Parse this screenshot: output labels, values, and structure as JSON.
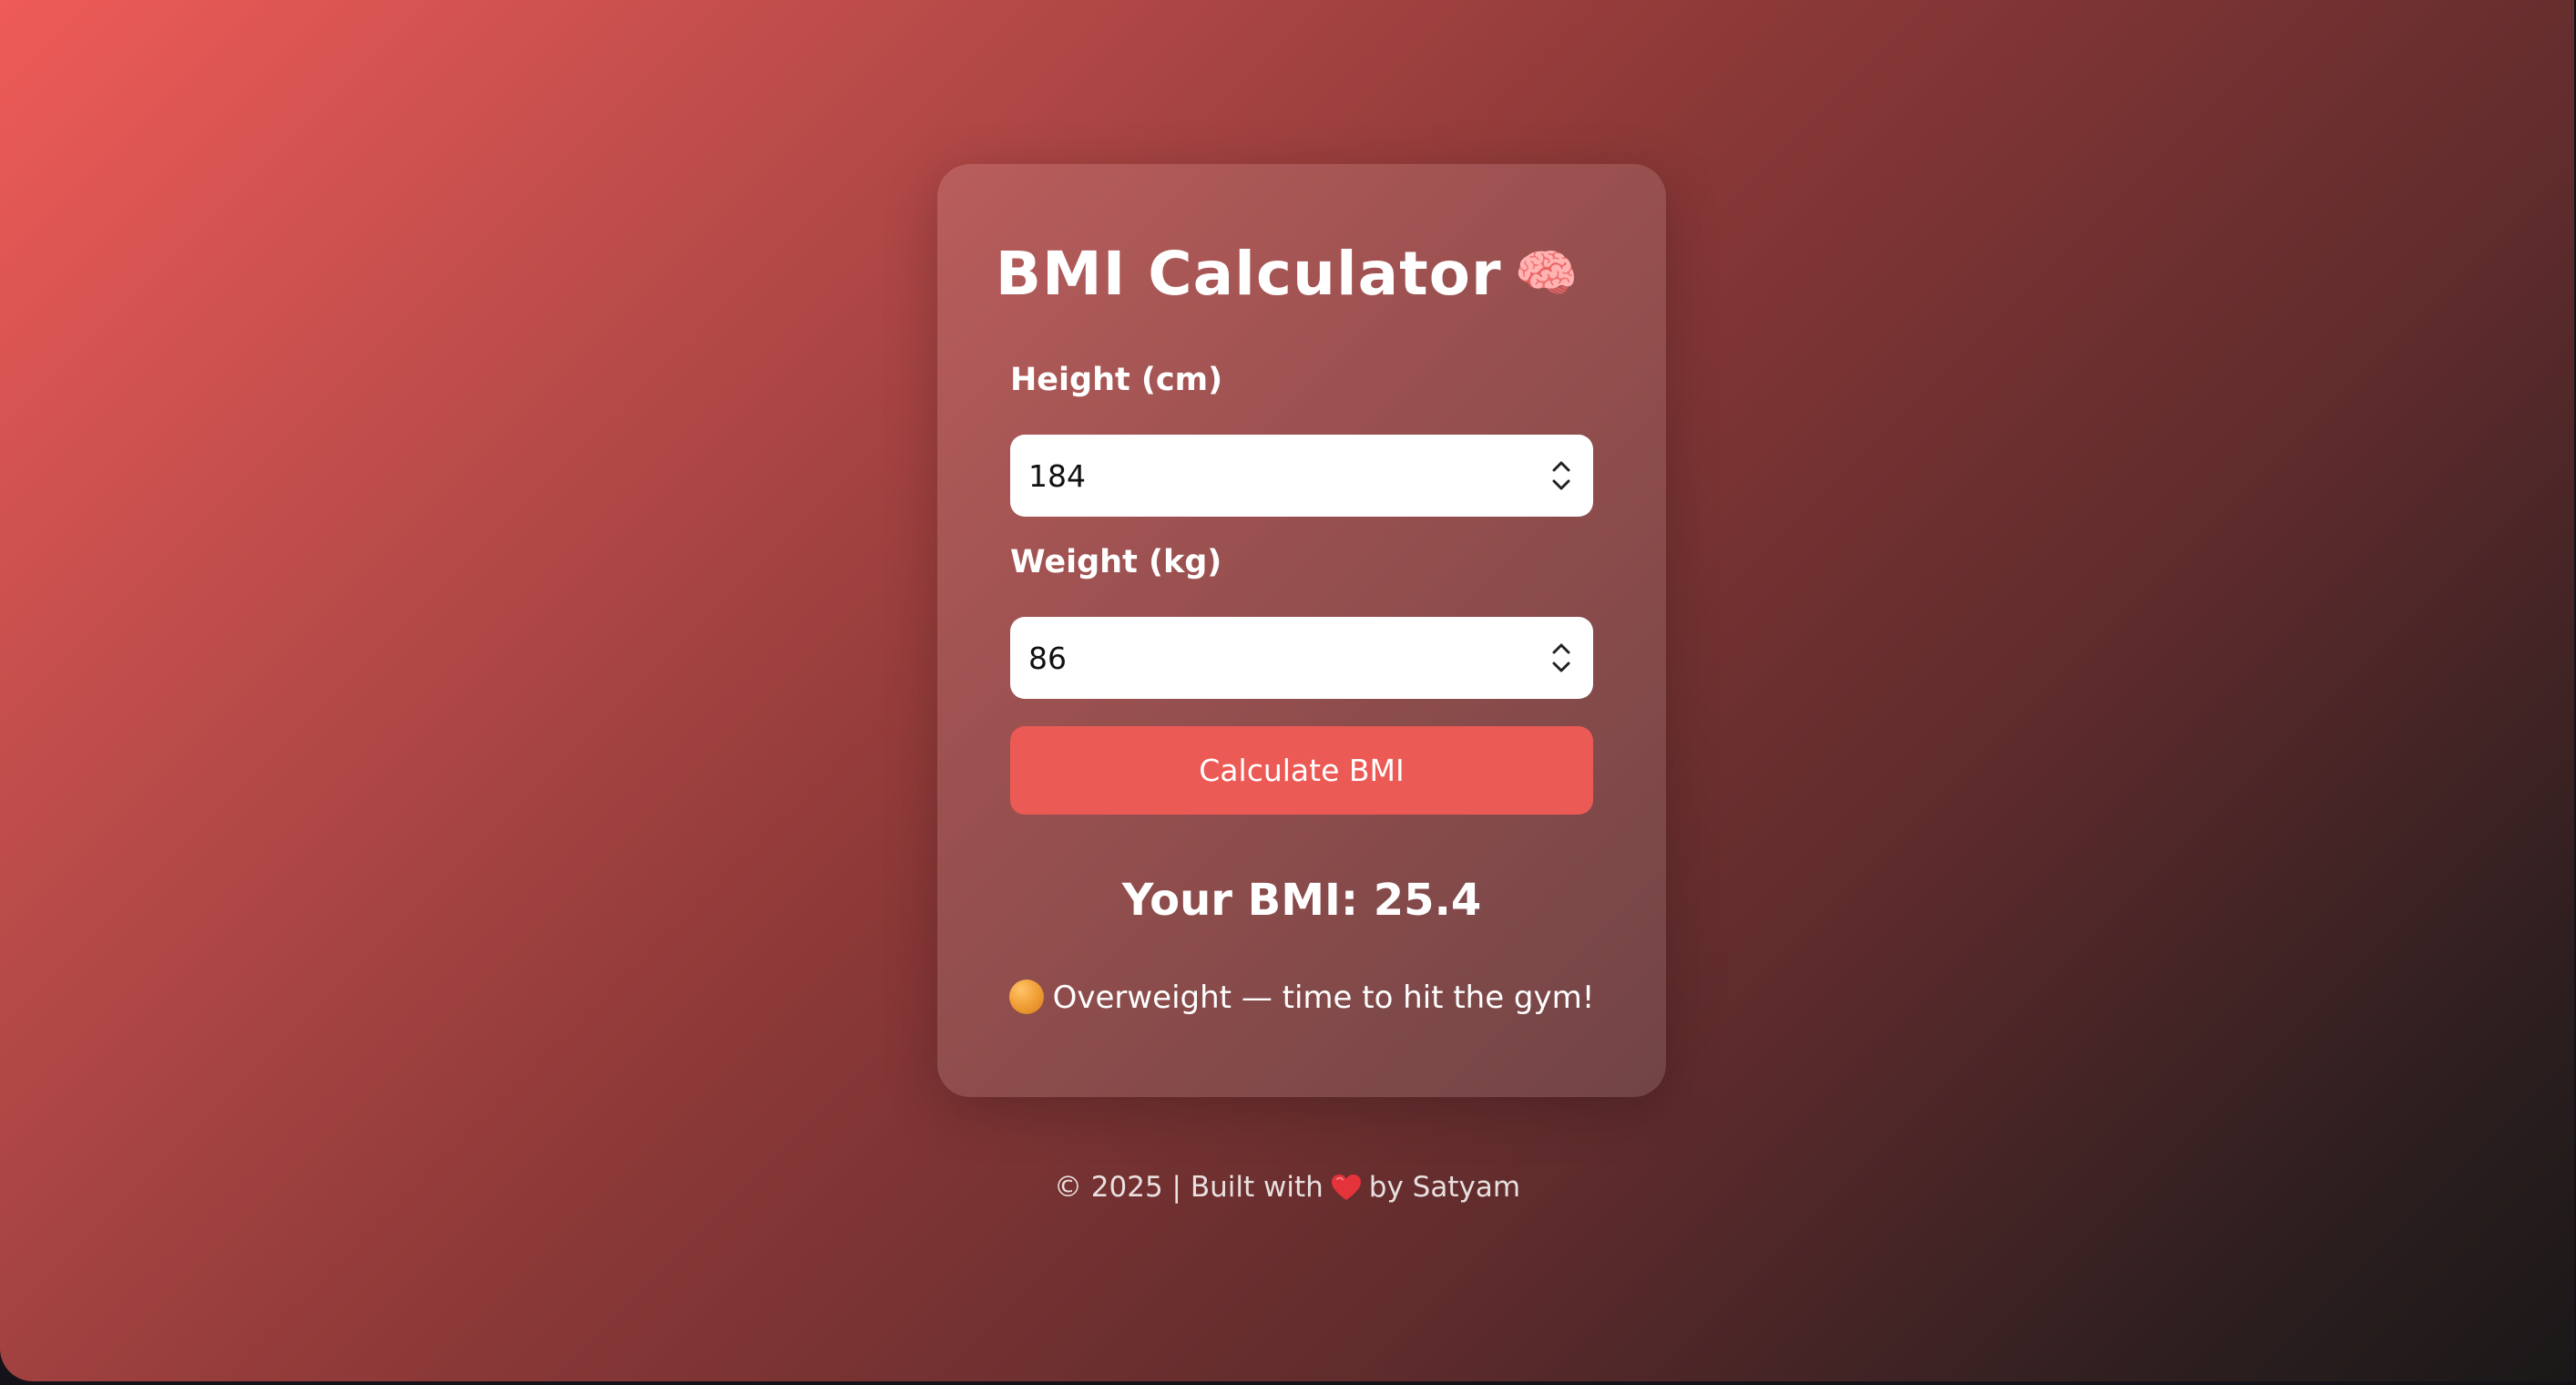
{
  "title": {
    "text": "BMI Calculator",
    "emoji": "🧠"
  },
  "form": {
    "height_label": "Height (cm)",
    "height_value": "184",
    "weight_label": "Weight (kg)",
    "weight_value": "86",
    "button_label": "Calculate BMI"
  },
  "result": {
    "text": "Your BMI: 25.4",
    "status": "Overweight — time to hit the gym!",
    "status_icon": "orange-circle-icon"
  },
  "footer": {
    "prefix": "© 2025 | Built with",
    "heart_icon": "heart-icon",
    "suffix": "by Satyam"
  },
  "colors": {
    "accent": "#ec5a56",
    "status_dot": "#f2a23a",
    "heart": "#e5333c"
  }
}
